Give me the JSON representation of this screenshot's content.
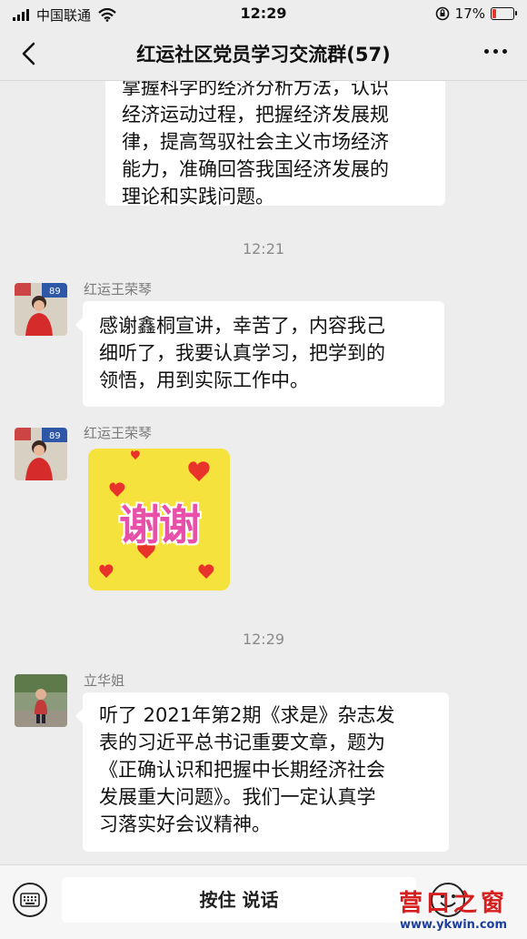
{
  "status_bar": {
    "carrier": "中国联通",
    "time": "12:29",
    "battery": "17%"
  },
  "header": {
    "title": "红运社区党员学习交流群(57)"
  },
  "messages": {
    "m1": {
      "text": "掌握科学的经济分析方法，认识\n经济运动过程，把握经济发展规\n律，提高驾驭社会主义市场经济\n能力，准确回答我国经济发展的\n理论和实践问题。"
    },
    "ts1": "12:21",
    "m2": {
      "sender": "红运王荣琴",
      "text": "感谢鑫桐宣讲，幸苦了，内容我己\n细听了，我要认真学习，把学到的\n领悟，用到实际工作中。"
    },
    "m3": {
      "sender": "红运王荣琴",
      "sticker_text": "谢谢"
    },
    "ts2": "12:29",
    "m4": {
      "sender": "立华姐",
      "text": "听了 2021年第2期《求是》杂志发\n表的习近平总书记重要文章，题为\n《正确认识和把握中长期经济社会\n发展重大问题》。我们一定认真学\n习落实好会议精神。"
    }
  },
  "input_bar": {
    "hold_to_talk": "按住 说话"
  },
  "watermark": {
    "name": "营口之窗",
    "url": "www.ykwin.com"
  },
  "icons": [
    "signal-icon",
    "wifi-icon",
    "rotation-lock-icon",
    "battery-icon",
    "back-chevron-icon",
    "more-dots-icon",
    "keyboard-icon",
    "emoji-icon"
  ]
}
